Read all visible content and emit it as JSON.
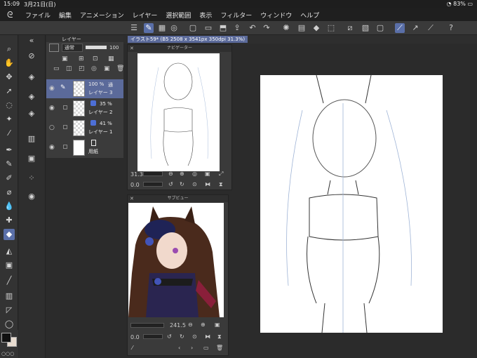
{
  "status": {
    "time": "15:09",
    "date": "3月21日(日)",
    "battery": "83%"
  },
  "menu": [
    "ファイル",
    "編集",
    "アニメーション",
    "レイヤー",
    "選択範囲",
    "表示",
    "フィルター",
    "ウィンドウ",
    "ヘルプ"
  ],
  "layer_panel": {
    "tab_label": "レイヤー",
    "blend_mode": "通常",
    "opacity": "100",
    "layers": [
      {
        "name": "レイヤー 3",
        "opacity": "100 %",
        "mode": "通",
        "selected": true
      },
      {
        "name": "レイヤー 2",
        "opacity": "35 %",
        "selected": false
      },
      {
        "name": "レイヤー 1",
        "opacity": "41 %",
        "selected": false
      },
      {
        "name": "用紙",
        "opacity": "",
        "selected": false
      }
    ]
  },
  "canvas_tab": {
    "title": "イラスト59* (B5 2508 x 3541px 350dpi 31.3%)"
  },
  "navigator": {
    "title": "ナビゲーター",
    "zoom": "31.3",
    "rotation": "0.0"
  },
  "subview": {
    "title": "サブビュー",
    "zoom": "241.5",
    "rotation": "0.0"
  },
  "colors": {
    "accent": "#5b6a9a",
    "main_color": "#111111",
    "sub_color": "#e8dcd0"
  }
}
